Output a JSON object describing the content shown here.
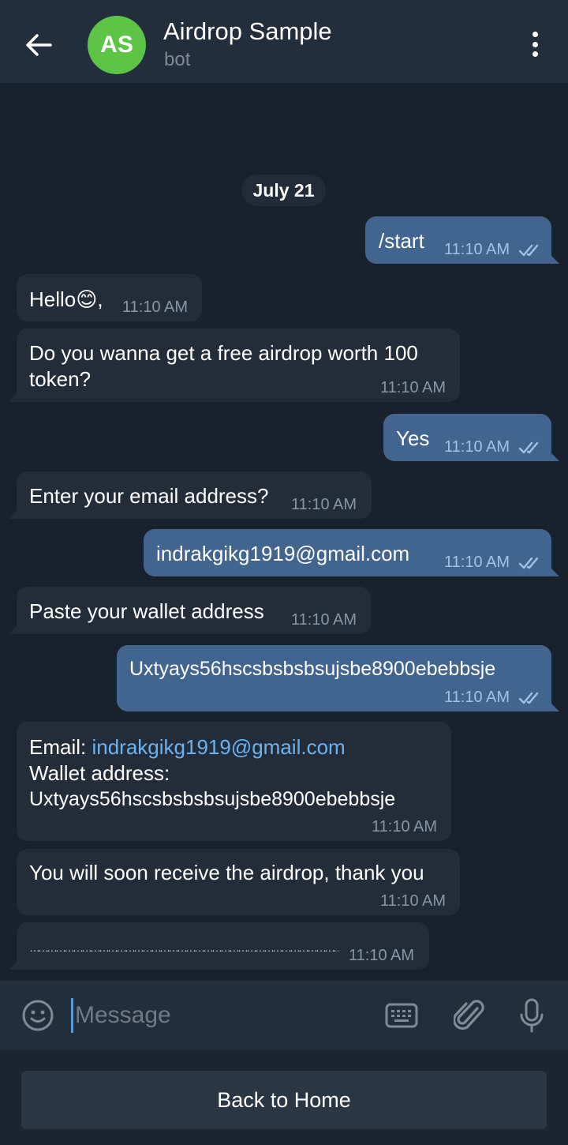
{
  "header": {
    "avatar_initials": "AS",
    "title": "Airdrop Sample",
    "subtitle": "bot",
    "back_icon": "arrow-left-icon",
    "menu_icon": "more-vertical-icon",
    "avatar_color": "#5ec447"
  },
  "date_divider": "July 21",
  "messages": [
    {
      "dir": "out",
      "text": "/start",
      "time": "11:10 AM"
    },
    {
      "dir": "in",
      "text": "Hello😊,",
      "time": "11:10 AM"
    },
    {
      "dir": "in",
      "text": "Do you wanna get a free airdrop worth 100 token?",
      "time": "11:10 AM"
    },
    {
      "dir": "out",
      "text": "Yes",
      "time": "11:10 AM"
    },
    {
      "dir": "in",
      "text": "Enter your email address?",
      "time": "11:10 AM"
    },
    {
      "dir": "out",
      "text": "indrakgikg1919@gmail.com",
      "time": "11:10 AM"
    },
    {
      "dir": "in",
      "text": "Paste your wallet address",
      "time": "11:10 AM"
    },
    {
      "dir": "out",
      "text": "Uxtyays56hscsbsbsbsujsbe8900ebebbsje",
      "time": "11:10 AM"
    },
    {
      "dir": "in",
      "email_label": "Email: ",
      "email_value": "indrakgikg1919@gmail.com",
      "wallet_label": "Wallet address:",
      "wallet_value": "Uxtyays56hscsbsbsbsujsbe8900ebebbsje",
      "time": "11:10 AM"
    },
    {
      "dir": "in",
      "text": "You will soon receive the airdrop, thank you",
      "time": "11:10 AM"
    },
    {
      "dir": "in",
      "text": "……………………………………………………………………………………………………………………………………………………………………",
      "time": "11:10 AM"
    }
  ],
  "composer": {
    "placeholder": "Message",
    "emoji_icon": "smile-icon",
    "keyboard_icon": "keyboard-icon",
    "attach_icon": "paperclip-icon",
    "mic_icon": "microphone-icon"
  },
  "bottom_button": "Back to Home",
  "colors": {
    "background": "#18212c",
    "header": "#232e3c",
    "incoming_bubble": "#232d3a",
    "outgoing_bubble": "#426590",
    "link": "#6cb3f0"
  }
}
